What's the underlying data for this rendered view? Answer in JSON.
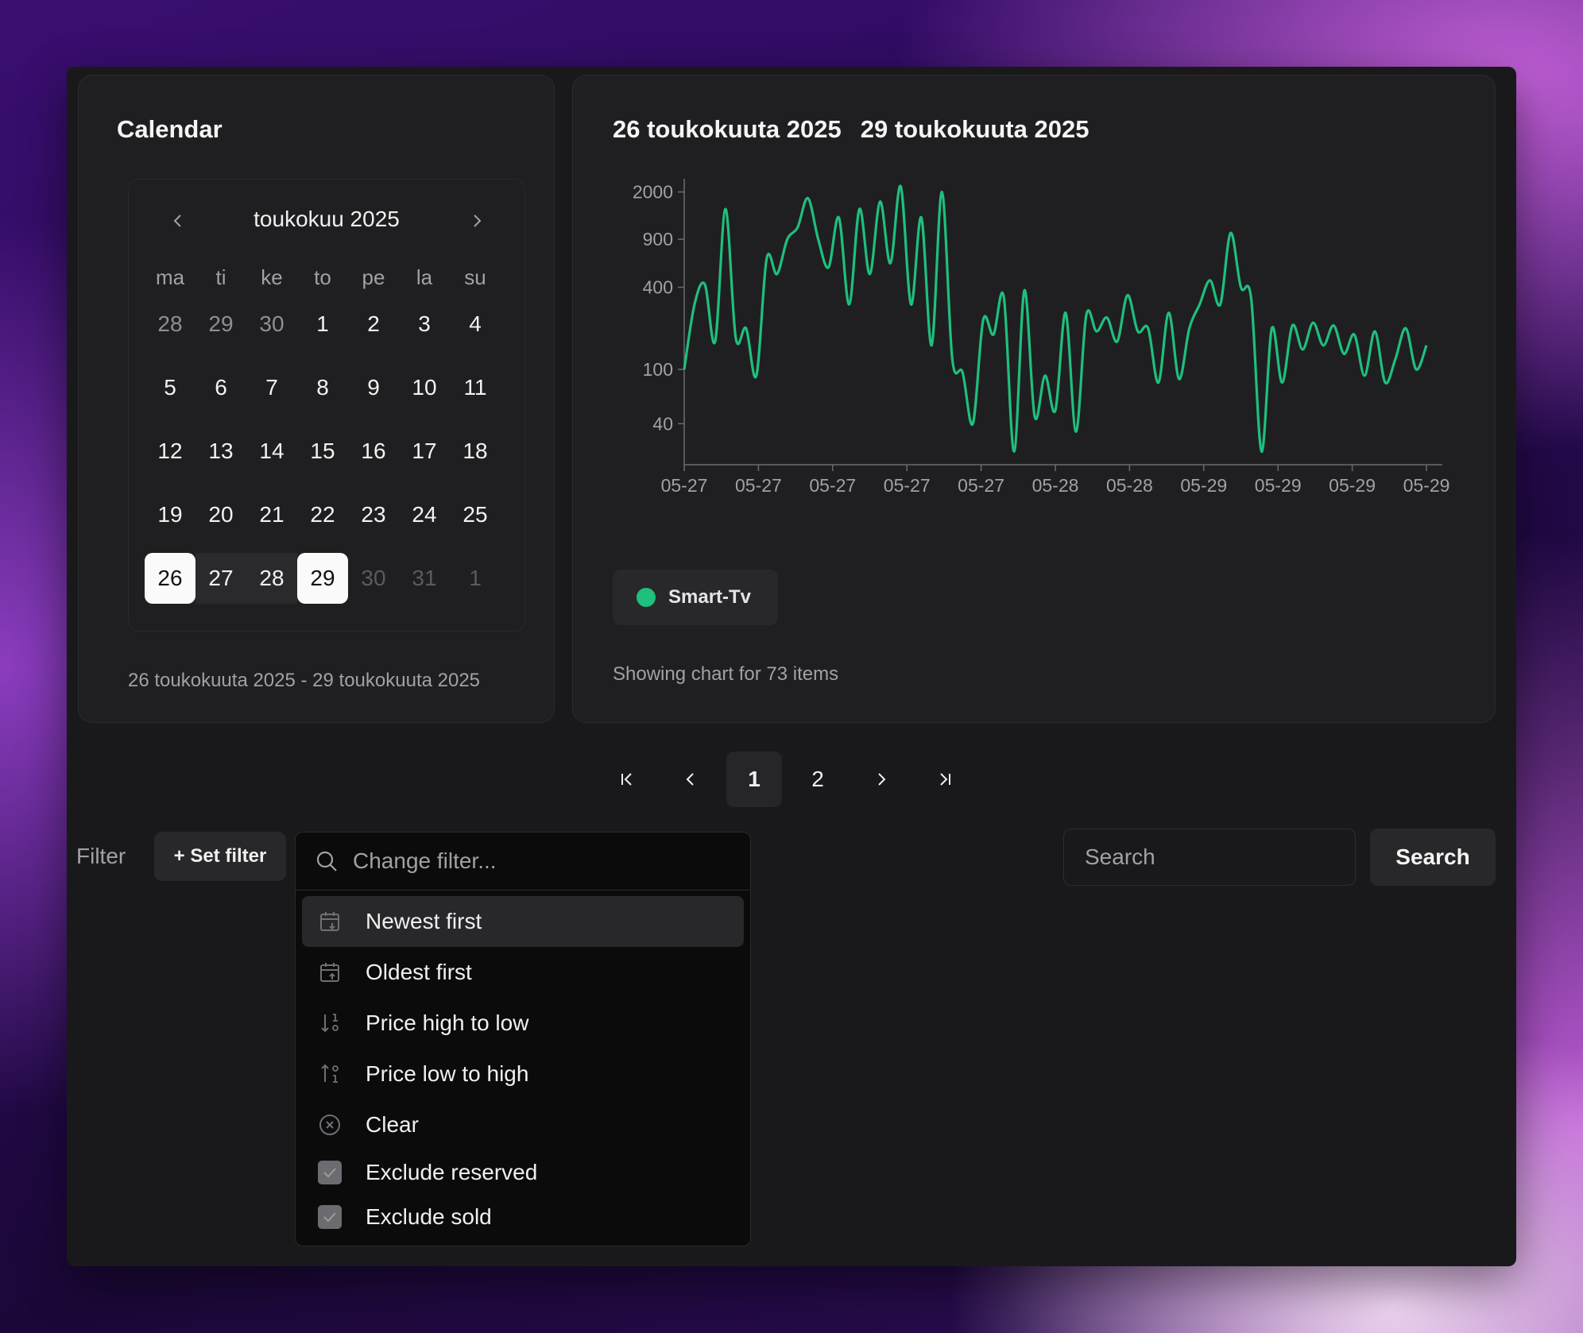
{
  "calendar": {
    "title": "Calendar",
    "month_label": "toukokuu 2025",
    "weekdays": [
      "ma",
      "ti",
      "ke",
      "to",
      "pe",
      "la",
      "su"
    ],
    "weeks": [
      [
        {
          "d": "28",
          "s": "out"
        },
        {
          "d": "29",
          "s": "out"
        },
        {
          "d": "30",
          "s": "out"
        },
        {
          "d": "1",
          "s": ""
        },
        {
          "d": "2",
          "s": ""
        },
        {
          "d": "3",
          "s": ""
        },
        {
          "d": "4",
          "s": ""
        }
      ],
      [
        {
          "d": "5",
          "s": ""
        },
        {
          "d": "6",
          "s": ""
        },
        {
          "d": "7",
          "s": ""
        },
        {
          "d": "8",
          "s": ""
        },
        {
          "d": "9",
          "s": ""
        },
        {
          "d": "10",
          "s": ""
        },
        {
          "d": "11",
          "s": ""
        }
      ],
      [
        {
          "d": "12",
          "s": ""
        },
        {
          "d": "13",
          "s": ""
        },
        {
          "d": "14",
          "s": ""
        },
        {
          "d": "15",
          "s": ""
        },
        {
          "d": "16",
          "s": ""
        },
        {
          "d": "17",
          "s": ""
        },
        {
          "d": "18",
          "s": ""
        }
      ],
      [
        {
          "d": "19",
          "s": ""
        },
        {
          "d": "20",
          "s": ""
        },
        {
          "d": "21",
          "s": ""
        },
        {
          "d": "22",
          "s": ""
        },
        {
          "d": "23",
          "s": ""
        },
        {
          "d": "24",
          "s": ""
        },
        {
          "d": "25",
          "s": ""
        }
      ],
      [
        {
          "d": "26",
          "s": "sel"
        },
        {
          "d": "27",
          "s": "range"
        },
        {
          "d": "28",
          "s": "range"
        },
        {
          "d": "29",
          "s": "sel"
        },
        {
          "d": "30",
          "s": "dim"
        },
        {
          "d": "31",
          "s": "dim"
        },
        {
          "d": "1",
          "s": "dim"
        }
      ]
    ],
    "range_caption": "26 toukokuuta 2025 - 29 toukokuuta 2025"
  },
  "chart_card": {
    "title_start": "26 toukokuuta 2025",
    "title_end": "29 toukokuuta 2025",
    "legend_label": "Smart-Tv",
    "legend_color": "#1fbf7d",
    "caption": "Showing chart for 73 items"
  },
  "chart_data": {
    "type": "line",
    "y_scale": "log",
    "ylim": [
      20,
      2500
    ],
    "y_ticks": [
      40,
      100,
      400,
      900,
      2000
    ],
    "x_tick_labels": [
      "05-27",
      "05-27",
      "05-27",
      "05-27",
      "05-27",
      "05-28",
      "05-28",
      "05-29",
      "05-29",
      "05-29",
      "05-29"
    ],
    "series": [
      {
        "color": "#1fbf7d",
        "values": [
          100,
          300,
          420,
          160,
          1500,
          170,
          200,
          90,
          650,
          500,
          900,
          1100,
          1800,
          900,
          560,
          1300,
          300,
          1500,
          500,
          1700,
          600,
          2200,
          300,
          1300,
          150,
          2000,
          120,
          95,
          40,
          230,
          180,
          340,
          25,
          380,
          45,
          90,
          50,
          260,
          35,
          250,
          190,
          240,
          160,
          350,
          190,
          200,
          80,
          260,
          85,
          200,
          300,
          450,
          300,
          1000,
          400,
          330,
          25,
          200,
          80,
          210,
          140,
          220,
          150,
          210,
          130,
          180,
          90,
          190,
          80,
          120,
          200,
          100,
          150
        ]
      }
    ]
  },
  "pagination": {
    "first_icon": "first-page-icon",
    "prev_icon": "chevron-left-icon",
    "pages": [
      "1",
      "2"
    ],
    "active_page": "1",
    "next_icon": "chevron-right-icon",
    "last_icon": "last-page-icon"
  },
  "filter": {
    "label": "Filter",
    "set_button": "+ Set filter",
    "search_placeholder": "Change filter...",
    "options": [
      {
        "label": "Newest first",
        "icon": "calendar-down-icon"
      },
      {
        "label": "Oldest first",
        "icon": "calendar-up-icon"
      },
      {
        "label": "Price high to low",
        "icon": "sort-desc-icon"
      },
      {
        "label": "Price low to high",
        "icon": "sort-asc-icon"
      },
      {
        "label": "Clear",
        "icon": "circle-x-icon"
      }
    ],
    "checkboxes": [
      {
        "label": "Exclude reserved",
        "checked": true
      },
      {
        "label": "Exclude sold",
        "checked": true
      }
    ]
  },
  "search": {
    "placeholder": "Search",
    "button_label": "Search"
  }
}
